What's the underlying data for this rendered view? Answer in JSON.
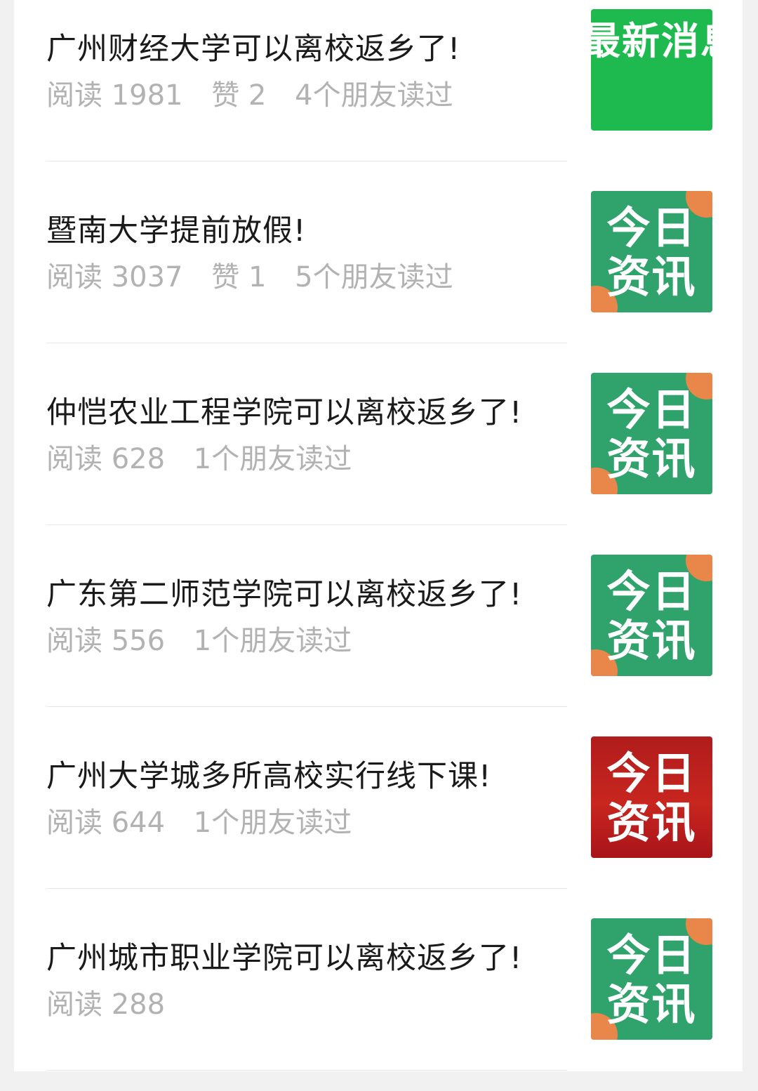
{
  "articles": [
    {
      "title": "广州财经大学可以离校返乡了!",
      "reads": "阅读 1981",
      "likes": "赞 2",
      "friends": "4个朋友读过",
      "thumbnail": {
        "style": "bright",
        "text": "最新消息",
        "color": "#1fba4f"
      }
    },
    {
      "title": "暨南大学提前放假!",
      "reads": "阅读 3037",
      "likes": "赞 1",
      "friends": "5个朋友读过",
      "thumbnail": {
        "style": "green",
        "line1": "今日",
        "line2": "资讯",
        "color": "#2fa36b"
      }
    },
    {
      "title": "仲恺农业工程学院可以离校返乡了!",
      "reads": "阅读 628",
      "likes": "",
      "friends": "1个朋友读过",
      "thumbnail": {
        "style": "green",
        "line1": "今日",
        "line2": "资讯",
        "color": "#2fa36b"
      }
    },
    {
      "title": "广东第二师范学院可以离校返乡了!",
      "reads": "阅读 556",
      "likes": "",
      "friends": "1个朋友读过",
      "thumbnail": {
        "style": "green",
        "line1": "今日",
        "line2": "资讯",
        "color": "#2fa36b"
      }
    },
    {
      "title": "广州大学城多所高校实行线下课!",
      "reads": "阅读 644",
      "likes": "",
      "friends": "1个朋友读过",
      "thumbnail": {
        "style": "red",
        "line1": "今日",
        "line2": "资讯",
        "color": "#b01c1c"
      }
    },
    {
      "title": "广州城市职业学院可以离校返乡了!",
      "reads": "阅读 288",
      "likes": "",
      "friends": "",
      "thumbnail": {
        "style": "green",
        "line1": "今日",
        "line2": "资讯",
        "color": "#2fa36b"
      }
    }
  ]
}
